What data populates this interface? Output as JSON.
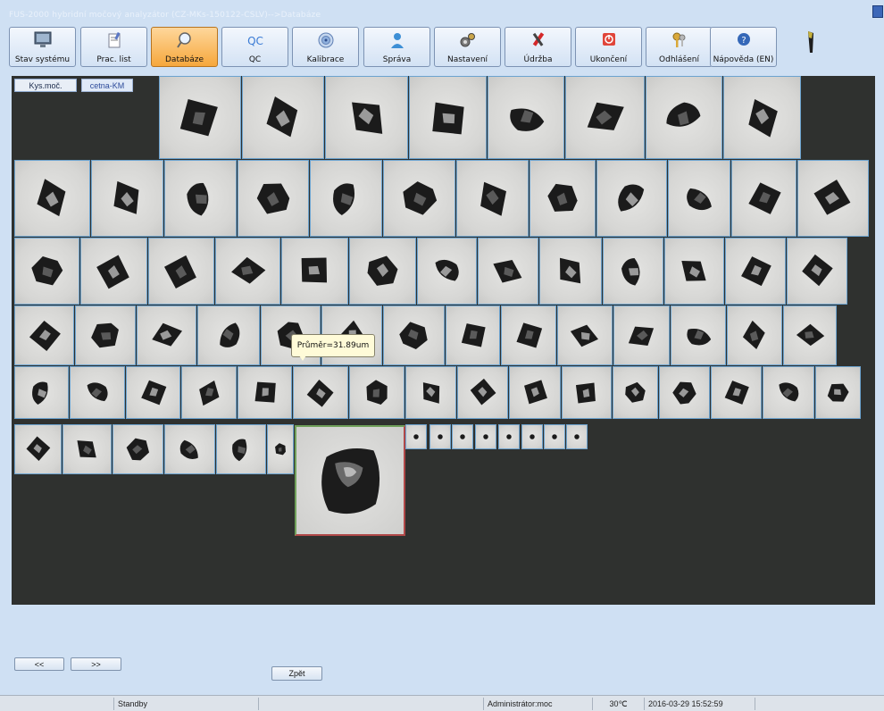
{
  "window": {
    "title": "FUS-2000 hybridní močový analyzátor (CZ-MKs-150122-CSLV)-->Databáze"
  },
  "toolbar": {
    "items": [
      {
        "label": "Stav systému",
        "icon": "monitor-icon",
        "active": false
      },
      {
        "label": "Prac. list",
        "icon": "worklist-icon",
        "active": false
      },
      {
        "label": "Databáze",
        "icon": "magnifier-icon",
        "active": true
      },
      {
        "label": "QC",
        "icon": "qc-icon",
        "active": false
      },
      {
        "label": "Kalibrace",
        "icon": "target-icon",
        "active": false
      },
      {
        "label": "Správa",
        "icon": "user-icon",
        "active": false
      },
      {
        "label": "Nastavení",
        "icon": "gears-icon",
        "active": false
      },
      {
        "label": "Údržba",
        "icon": "tools-icon",
        "active": false
      },
      {
        "label": "Ukončení",
        "icon": "power-icon",
        "active": false
      },
      {
        "label": "Odhlášení",
        "icon": "keys-icon",
        "active": false
      },
      {
        "label": "Nápověda (EN)",
        "icon": "help-icon",
        "active": false
      }
    ]
  },
  "filters": {
    "kys_label": "Kys.moč.",
    "cetna_label": "cetna-KM"
  },
  "gallery": {
    "tooltip": "Průměr=31.89um",
    "row_counts": [
      8,
      12,
      14,
      14,
      15,
      15
    ]
  },
  "navigation": {
    "prev_label": "<<",
    "next_label": ">>",
    "back_label": "Zpět"
  },
  "status": {
    "left": "",
    "state": "Standby",
    "message": "",
    "user": "Administrátor:moc",
    "temperature": "30℃",
    "datetime": "2016-03-29 15:52:59"
  },
  "colors": {
    "active_tab": "#f6a73c",
    "viewer_bg": "#2f312f",
    "cell_border": "#6ca3cf"
  }
}
